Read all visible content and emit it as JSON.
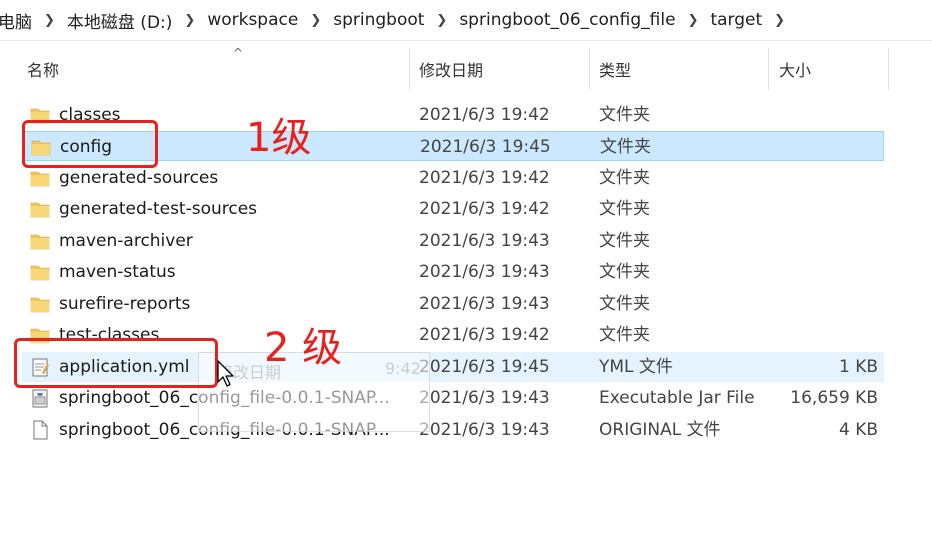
{
  "breadcrumb": [
    "电脑",
    "本地磁盘 (D:)",
    "workspace",
    "springboot",
    "springboot_06_config_file",
    "target"
  ],
  "columns": {
    "name": "名称",
    "date": "修改日期",
    "type": "类型",
    "size": "大小"
  },
  "files": [
    {
      "name": "classes",
      "date": "2021/6/3 19:42",
      "type": "文件夹",
      "size": "",
      "icon": "folder-icon"
    },
    {
      "name": "config",
      "date": "2021/6/3 19:45",
      "type": "文件夹",
      "size": "",
      "icon": "folder-icon"
    },
    {
      "name": "generated-sources",
      "date": "2021/6/3 19:42",
      "type": "文件夹",
      "size": "",
      "icon": "folder-icon"
    },
    {
      "name": "generated-test-sources",
      "date": "2021/6/3 19:42",
      "type": "文件夹",
      "size": "",
      "icon": "folder-icon"
    },
    {
      "name": "maven-archiver",
      "date": "2021/6/3 19:43",
      "type": "文件夹",
      "size": "",
      "icon": "folder-icon"
    },
    {
      "name": "maven-status",
      "date": "2021/6/3 19:43",
      "type": "文件夹",
      "size": "",
      "icon": "folder-icon"
    },
    {
      "name": "surefire-reports",
      "date": "2021/6/3 19:43",
      "type": "文件夹",
      "size": "",
      "icon": "folder-icon"
    },
    {
      "name": "test-classes",
      "date": "2021/6/3 19:42",
      "type": "文件夹",
      "size": "",
      "icon": "folder-icon"
    },
    {
      "name": "application.yml",
      "date": "2021/6/3 19:45",
      "type": "YML 文件",
      "size": "1 KB",
      "icon": "yml-file-icon"
    },
    {
      "name": "springboot_06_config_file-0.0.1-SNAP...",
      "date": "2021/6/3 19:43",
      "type": "Executable Jar File",
      "size": "16,659 KB",
      "icon": "jar-file-icon"
    },
    {
      "name": "springboot_06_config_file-0.0.1-SNAP...",
      "date": "2021/6/3 19:43",
      "type": "ORIGINAL 文件",
      "size": "4 KB",
      "icon": "file-icon"
    }
  ],
  "annotations": {
    "label1": "1级",
    "label2": "2 级"
  },
  "drag_ghost": {
    "line1": "修改日期",
    "line2": "9:42"
  },
  "colors": {
    "selected_bg": "#cce8ff",
    "annotation": "#e8211f",
    "folder": "#f2c55c"
  }
}
